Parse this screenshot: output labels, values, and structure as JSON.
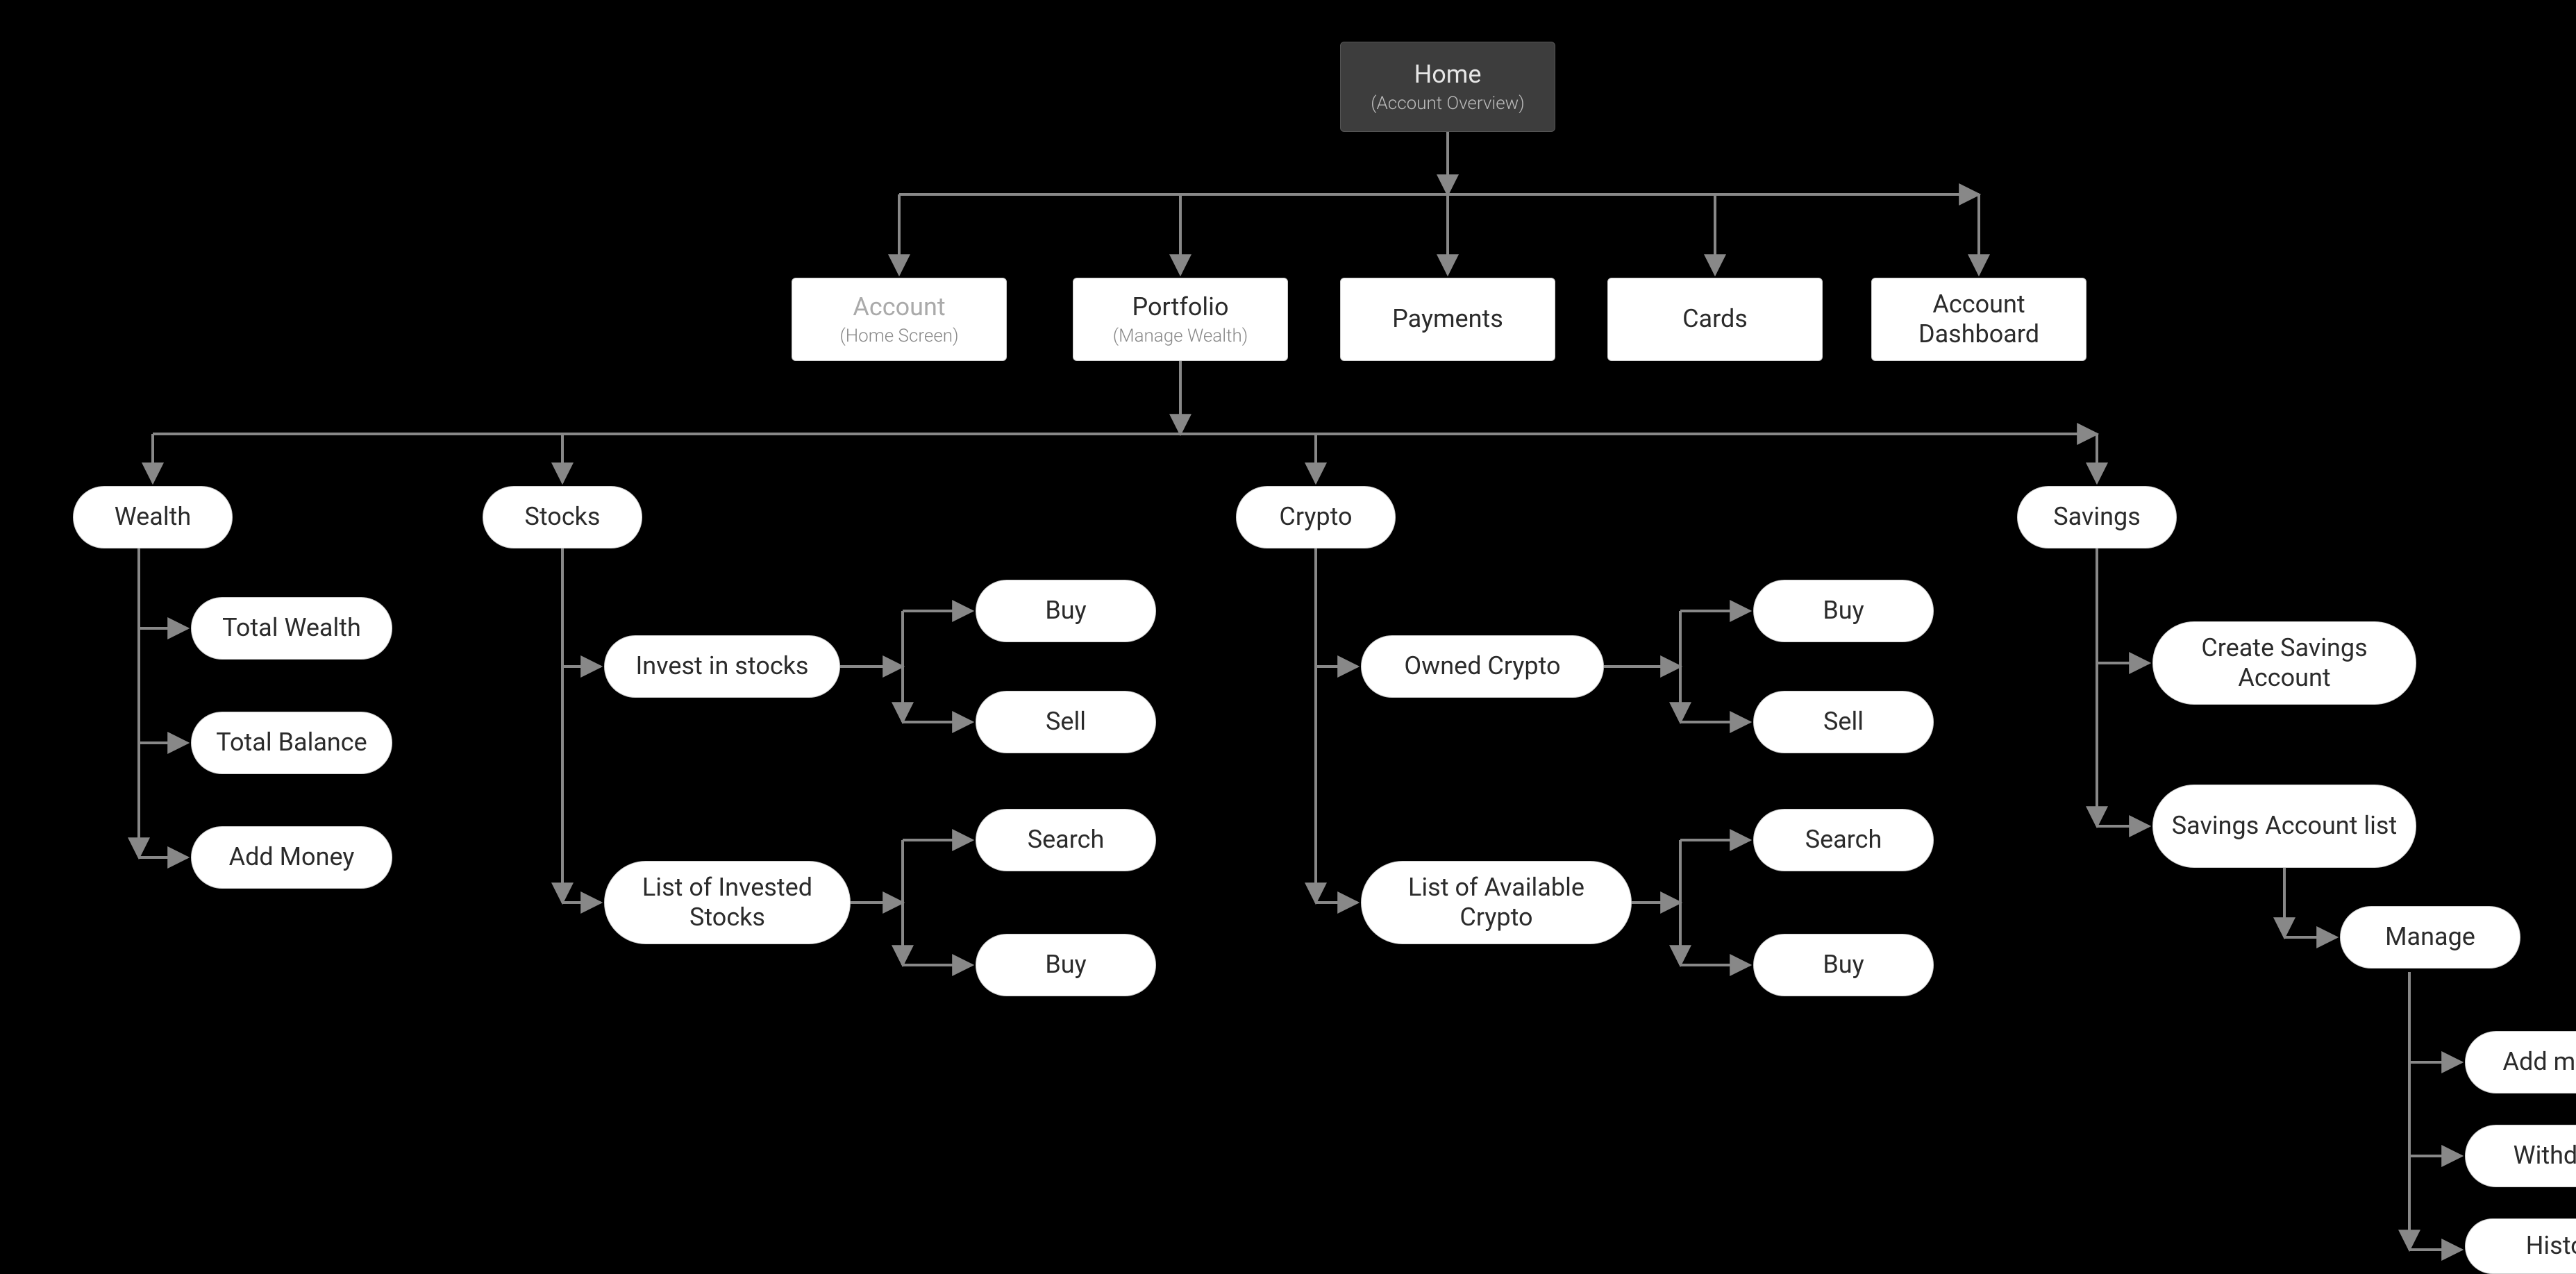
{
  "root": {
    "title": "Home",
    "subtitle": "(Account Overview)"
  },
  "level1": {
    "account": {
      "title": "Account",
      "subtitle": "(Home Screen)"
    },
    "portfolio": {
      "title": "Portfolio",
      "subtitle": "(Manage Wealth)"
    },
    "payments": {
      "title": "Payments"
    },
    "cards": {
      "title": "Cards"
    },
    "dashboard": {
      "title": "Account Dashboard"
    }
  },
  "portfolio_children": {
    "wealth": {
      "title": "Wealth"
    },
    "stocks": {
      "title": "Stocks"
    },
    "crypto": {
      "title": "Crypto"
    },
    "savings": {
      "title": "Savings"
    }
  },
  "wealth_children": {
    "total_wealth": {
      "title": "Total Wealth"
    },
    "total_balance": {
      "title": "Total Balance"
    },
    "add_money": {
      "title": "Add Money"
    }
  },
  "stocks_children": {
    "invest": {
      "title": "Invest in stocks"
    },
    "list": {
      "title": "List of Invested Stocks"
    }
  },
  "stocks_invest_children": {
    "buy": {
      "title": "Buy"
    },
    "sell": {
      "title": "Sell"
    }
  },
  "stocks_list_children": {
    "search": {
      "title": "Search"
    },
    "buy": {
      "title": "Buy"
    }
  },
  "crypto_children": {
    "owned": {
      "title": "Owned Crypto"
    },
    "list": {
      "title": "List of Available Crypto"
    }
  },
  "crypto_owned_children": {
    "buy": {
      "title": "Buy"
    },
    "sell": {
      "title": "Sell"
    }
  },
  "crypto_list_children": {
    "search": {
      "title": "Search"
    },
    "buy": {
      "title": "Buy"
    }
  },
  "savings_children": {
    "create": {
      "title": "Create Savings Account"
    },
    "list": {
      "title": "Savings Account list"
    }
  },
  "savings_manage": {
    "title": "Manage"
  },
  "savings_manage_children": {
    "add": {
      "title": "Add money"
    },
    "withdraw": {
      "title": "Withdraw"
    },
    "history": {
      "title": "History"
    }
  }
}
